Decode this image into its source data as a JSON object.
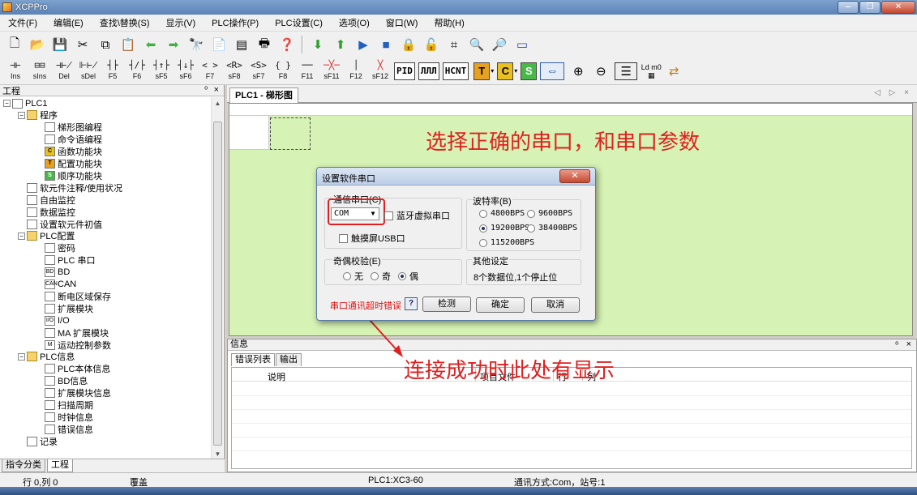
{
  "app": {
    "title": "XCPPro",
    "window_buttons": [
      "‒",
      "❐",
      "✕"
    ]
  },
  "menu": [
    "文件(F)",
    "编辑(E)",
    "查找\\替换(S)",
    "显示(V)",
    "PLC操作(P)",
    "PLC设置(C)",
    "选项(O)",
    "窗口(W)",
    "帮助(H)"
  ],
  "toolbar1": {
    "icons": [
      "new-file-icon",
      "open-folder-icon",
      "save-icon",
      "cut-icon",
      "copy-icon",
      "paste-icon",
      "back-arrow-icon",
      "forward-arrow-icon",
      "binoculars-icon",
      "document-icon",
      "table-icon",
      "print-icon",
      "help-query-icon",
      "download-icon",
      "upload-icon",
      "run-icon",
      "stop-icon",
      "lock-icon",
      "unlock-icon",
      "register-icon",
      "monitor-icon",
      "search-doc-icon",
      "link-icon"
    ]
  },
  "toolbar2": {
    "ladder_buttons": [
      {
        "sym": "⊣⊢",
        "label": "Ins"
      },
      {
        "sym": "⊟⊟",
        "label": "sIns"
      },
      {
        "sym": "⊣⊬",
        "label": "Del"
      },
      {
        "sym": "⊩⊬",
        "label": "sDel"
      },
      {
        "sym": "┤├",
        "label": "F5"
      },
      {
        "sym": "┤/├",
        "label": "F6"
      },
      {
        "sym": "┤↑├",
        "label": "sF5"
      },
      {
        "sym": "┤↓├",
        "label": "sF6"
      },
      {
        "sym": "< >",
        "label": "F7"
      },
      {
        "sym": "<R>",
        "label": "sF8"
      },
      {
        "sym": "<S>",
        "label": "sF7"
      },
      {
        "sym": "{ }",
        "label": "F8"
      },
      {
        "sym": "──",
        "label": "F11"
      },
      {
        "sym": "─╳─",
        "label": "sF11"
      },
      {
        "sym": "│",
        "label": "F12"
      },
      {
        "sym": "╳",
        "label": "sF12"
      }
    ],
    "box_buttons": [
      "PID",
      "ЛЛЛ",
      "HCNT"
    ],
    "color_buttons": [
      {
        "text": "T",
        "color": "#e8a020"
      },
      {
        "text": "C",
        "color": "#e8c020"
      },
      {
        "text": "S",
        "color": "#48b848"
      }
    ],
    "extra_icons": [
      "layout-icon",
      "zoom-in-icon",
      "zoom-out-icon",
      "ladder-view-icon",
      "ld-m0-icon",
      "convert-icon"
    ],
    "ld_label": "Ld m0"
  },
  "project_panel": {
    "title": "工程",
    "pin": "ᵒ",
    "close": "×",
    "tree": [
      {
        "label": "PLC1",
        "indent": 0,
        "icon": "plc-icon",
        "exp": "−"
      },
      {
        "label": "程序",
        "indent": 1,
        "icon": "program-icon",
        "exp": "−"
      },
      {
        "label": "梯形图编程",
        "indent": 2,
        "icon": "ladder-icon"
      },
      {
        "label": "命令语编程",
        "indent": 2,
        "icon": "instruction-icon"
      },
      {
        "label": "函数功能块",
        "indent": 2,
        "icon": "function-block-icon",
        "tag": "C"
      },
      {
        "label": "配置功能块",
        "indent": 2,
        "icon": "config-block-icon",
        "tag": "T"
      },
      {
        "label": "顺序功能块",
        "indent": 2,
        "icon": "sequence-block-icon",
        "tag": "S"
      },
      {
        "label": "软元件注释/使用状况",
        "indent": 1,
        "icon": "comment-icon"
      },
      {
        "label": "自由监控",
        "indent": 1,
        "icon": "free-monitor-icon"
      },
      {
        "label": "数据监控",
        "indent": 1,
        "icon": "data-monitor-icon"
      },
      {
        "label": "设置软元件初值",
        "indent": 1,
        "icon": "init-value-icon"
      },
      {
        "label": "PLC配置",
        "indent": 1,
        "icon": "folder-icon",
        "exp": "−"
      },
      {
        "label": "密码",
        "indent": 2,
        "icon": "password-icon"
      },
      {
        "label": "PLC 串口",
        "indent": 2,
        "icon": "serial-port-icon"
      },
      {
        "label": "BD",
        "indent": 2,
        "icon": "bd-icon",
        "tag": "BD"
      },
      {
        "label": "CAN",
        "indent": 2,
        "icon": "can-icon",
        "tag": "CAN"
      },
      {
        "label": "断电区域保存",
        "indent": 2,
        "icon": "power-save-icon"
      },
      {
        "label": "扩展模块",
        "indent": 2,
        "icon": "expansion-module-icon"
      },
      {
        "label": "I/O",
        "indent": 2,
        "icon": "io-icon",
        "tag": "I/O"
      },
      {
        "label": "MA 扩展模块",
        "indent": 2,
        "icon": "ma-module-icon"
      },
      {
        "label": "运动控制参数",
        "indent": 2,
        "icon": "motion-param-icon",
        "tag": "M"
      },
      {
        "label": "PLC信息",
        "indent": 1,
        "icon": "folder-icon",
        "exp": "−"
      },
      {
        "label": "PLC本体信息",
        "indent": 2,
        "icon": "plc-info-icon"
      },
      {
        "label": "BD信息",
        "indent": 2,
        "icon": "bd-info-icon"
      },
      {
        "label": "扩展模块信息",
        "indent": 2,
        "icon": "module-info-icon"
      },
      {
        "label": "扫描周期",
        "indent": 2,
        "icon": "scan-cycle-icon"
      },
      {
        "label": "时钟信息",
        "indent": 2,
        "icon": "clock-icon"
      },
      {
        "label": "错误信息",
        "indent": 2,
        "icon": "error-icon"
      },
      {
        "label": "记录",
        "indent": 1,
        "icon": "record-icon"
      }
    ],
    "tabs": [
      "指令分类",
      "工程"
    ]
  },
  "document": {
    "tab": "PLC1 - 梯形图",
    "nav": "◁ ▷ ×"
  },
  "annotations": {
    "top": "选择正确的串口，和串口参数",
    "bottom": "连接成功时此处有显示"
  },
  "info_panel": {
    "title": "信息",
    "pin": "ᵒ",
    "close": "×",
    "tabs": [
      "错误列表",
      "输出"
    ],
    "columns": [
      "说明",
      "项目文件",
      "行",
      "列"
    ]
  },
  "status": {
    "position": "行 0,列 0",
    "mode": "覆盖",
    "plc": "PLC1:XC3-60",
    "comm": "通讯方式:Com，站号:1"
  },
  "dialog": {
    "title": "设置软件串口",
    "close": "✕",
    "port_group": "通信串口(C)",
    "port_value": "COM",
    "bluetooth_label": "蓝牙虚拟串口",
    "touch_usb_label": "触摸屏USB口",
    "baud_group": "波特率(B)",
    "baud_options": [
      {
        "label": "4800BPS",
        "checked": false
      },
      {
        "label": "9600BPS",
        "checked": false
      },
      {
        "label": "19200BPS",
        "checked": true
      },
      {
        "label": "38400BPS",
        "checked": false
      },
      {
        "label": "115200BPS",
        "checked": false
      }
    ],
    "parity_group": "奇偶校验(E)",
    "parity_options": [
      {
        "label": "无",
        "checked": false
      },
      {
        "label": "奇",
        "checked": false
      },
      {
        "label": "偶",
        "checked": true
      }
    ],
    "other_group": "其他设定",
    "other_text": "8个数据位,1个停止位",
    "timeout_link": "串口通讯超时错误",
    "help": "?",
    "buttons": {
      "detect": "检测",
      "ok": "确定",
      "cancel": "取消"
    }
  }
}
